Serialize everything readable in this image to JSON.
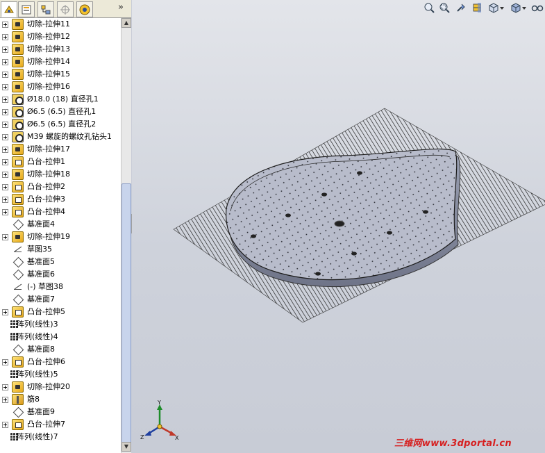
{
  "feature_tree": [
    {
      "icon": "cut-extrude-icon",
      "label": "切除-拉伸11",
      "expandable": true
    },
    {
      "icon": "cut-extrude-icon",
      "label": "切除-拉伸12",
      "expandable": true
    },
    {
      "icon": "cut-extrude-icon",
      "label": "切除-拉伸13",
      "expandable": true
    },
    {
      "icon": "cut-extrude-icon",
      "label": "切除-拉伸14",
      "expandable": true
    },
    {
      "icon": "cut-extrude-icon",
      "label": "切除-拉伸15",
      "expandable": true
    },
    {
      "icon": "cut-extrude-icon",
      "label": "切除-拉伸16",
      "expandable": true
    },
    {
      "icon": "hole-icon",
      "label": "Ø18.0 (18) 直径孔1",
      "expandable": true
    },
    {
      "icon": "hole-icon",
      "label": "Ø6.5 (6.5) 直径孔1",
      "expandable": true
    },
    {
      "icon": "hole-icon",
      "label": "Ø6.5 (6.5) 直径孔2",
      "expandable": true
    },
    {
      "icon": "hole-icon",
      "label": "M39 螺旋的螺纹孔钻头1",
      "expandable": true
    },
    {
      "icon": "cut-extrude-icon",
      "label": "切除-拉伸17",
      "expandable": true
    },
    {
      "icon": "boss-extrude-icon",
      "label": "凸台-拉伸1",
      "expandable": true
    },
    {
      "icon": "cut-extrude-icon",
      "label": "切除-拉伸18",
      "expandable": true
    },
    {
      "icon": "boss-extrude-icon",
      "label": "凸台-拉伸2",
      "expandable": true
    },
    {
      "icon": "boss-extrude-icon",
      "label": "凸台-拉伸3",
      "expandable": true
    },
    {
      "icon": "boss-extrude-icon",
      "label": "凸台-拉伸4",
      "expandable": true
    },
    {
      "icon": "plane-icon",
      "label": "基准面4",
      "expandable": false
    },
    {
      "icon": "cut-extrude-icon",
      "label": "切除-拉伸19",
      "expandable": true
    },
    {
      "icon": "sketch-icon",
      "label": "草图35",
      "expandable": false
    },
    {
      "icon": "plane-icon",
      "label": "基准面5",
      "expandable": false
    },
    {
      "icon": "plane-icon",
      "label": "基准面6",
      "expandable": false
    },
    {
      "icon": "sketch-icon",
      "label": "(-) 草图38",
      "expandable": false
    },
    {
      "icon": "plane-icon",
      "label": "基准面7",
      "expandable": false
    },
    {
      "icon": "boss-extrude-icon",
      "label": "凸台-拉伸5",
      "expandable": true
    },
    {
      "icon": "linear-pattern-icon",
      "label": "阵列(线性)3",
      "expandable": false
    },
    {
      "icon": "linear-pattern-icon",
      "label": "阵列(线性)4",
      "expandable": false
    },
    {
      "icon": "plane-icon",
      "label": "基准面8",
      "expandable": false
    },
    {
      "icon": "boss-extrude-icon",
      "label": "凸台-拉伸6",
      "expandable": true
    },
    {
      "icon": "linear-pattern-icon",
      "label": "阵列(线性)5",
      "expandable": false
    },
    {
      "icon": "cut-extrude-icon",
      "label": "切除-拉伸20",
      "expandable": true
    },
    {
      "icon": "rib-icon",
      "label": "筋8",
      "expandable": true
    },
    {
      "icon": "plane-icon",
      "label": "基准面9",
      "expandable": false
    },
    {
      "icon": "boss-extrude-icon",
      "label": "凸台-拉伸7",
      "expandable": true
    },
    {
      "icon": "linear-pattern-icon",
      "label": "阵列(线性)7",
      "expandable": false
    }
  ],
  "tabs": [
    "feature-manager-tab",
    "property-manager-tab",
    "configuration-manager-tab",
    "dimxpert-tab",
    "display-manager-tab"
  ],
  "tab_more_label": "»",
  "view_toolbar": [
    "zoom-to-fit-icon",
    "zoom-to-area-icon",
    "previous-view-icon",
    "section-view-icon",
    "view-orientation-icon",
    "display-style-icon",
    "hide-show-items-icon"
  ],
  "triad": {
    "x_label": "X",
    "y_label": "Y",
    "z_label": "Z"
  },
  "watermark": "三维网www.3dportal.cn",
  "colors": {
    "viewport_top": "#e3e5ea",
    "viewport_bottom": "#c8ccd6",
    "watermark": "#d62020"
  }
}
